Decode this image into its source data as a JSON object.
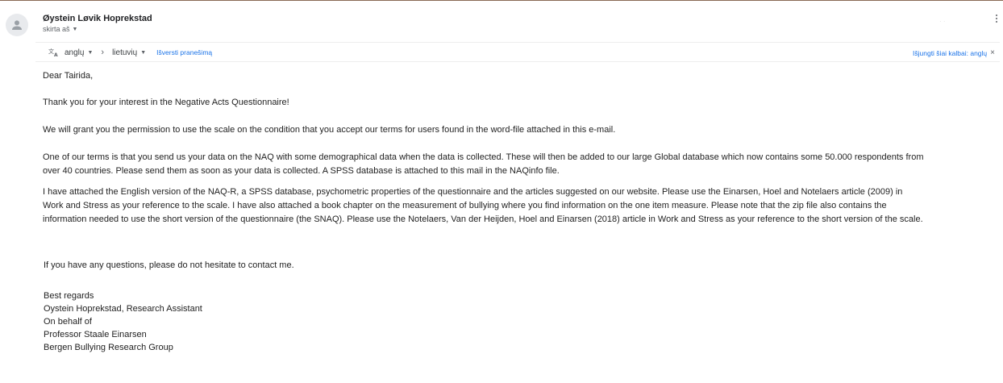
{
  "email": {
    "sender_name": "Øystein Løvik Hoprekstad",
    "to_label": "skirta aš",
    "translation": {
      "source_lang": "anglų",
      "target_lang": "lietuvių",
      "translate_link": "Išversti pranešimą",
      "disable_link": "Išjungti šiai kalbai: anglų"
    },
    "body": {
      "greeting": "Dear Tairida,",
      "p2": "Thank you for your interest in the Negative Acts Questionnaire!",
      "p3": "We will grant you the permission to use the scale on the condition that you accept our terms for users found in the word-file attached in this e-mail.",
      "p4_l1": "One of our terms is that you send us your data on the NAQ with some demographical data when the data is collected. These will then be added to our large Global database which now contains some 50.000 respondents from",
      "p4_l2": "over 40 countries. Please send them as soon as your data is collected. A SPSS database is attached to this mail in the NAQinfo file.",
      "p5_l1": "I have attached the English version of the NAQ-R, a SPSS database, psychometric properties of the questionnaire and the articles suggested on our website. Please use the Einarsen, Hoel and Notelaers article (2009) in",
      "p5_l2": "Work and Stress as your reference to the scale. I have also attached a book chapter on the measurement of bullying where you find information on the one item measure. Please note that the zip file also contains the",
      "p5_l3": "information needed to use the short version of the questionnaire (the SNAQ). Please use the Notelaers, Van der Heijden, Hoel and Einarsen (2018) article in Work and Stress as your reference to the short version of the scale.",
      "p6": "If you have any questions, please do not hesitate to contact me."
    },
    "signature": {
      "l1": "Best regards",
      "l2": "Oystein Hoprekstad, Research Assistant",
      "l3": "On behalf of",
      "l4": "Professor Staale Einarsen",
      "l5": "Bergen Bullying Research Group"
    }
  },
  "icons": {
    "avatar": "person-icon",
    "more": "more-vert-icon",
    "translate": "translate-icon"
  },
  "colors": {
    "link": "#1a73e8",
    "text": "#222222",
    "muted": "#5f6368"
  }
}
